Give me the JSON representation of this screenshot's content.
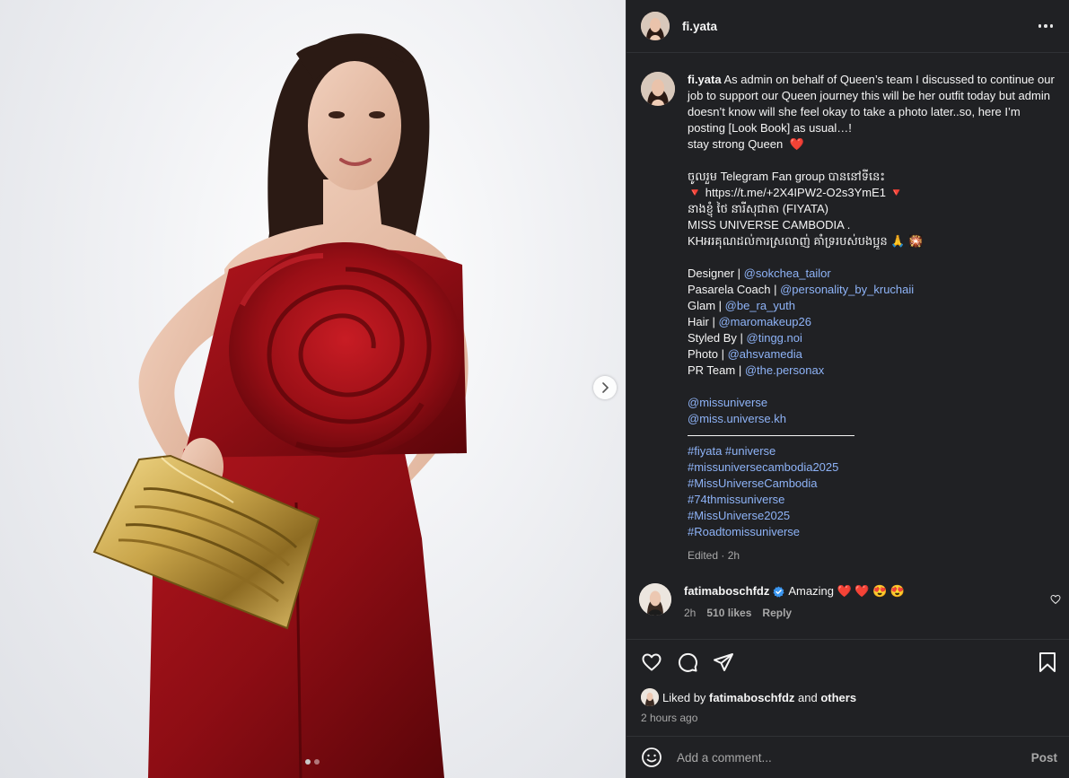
{
  "post": {
    "author": "fi.yata",
    "caption_intro": "As admin on behalf of Queen’s team I discussed to continue our job to support our Queen journey this will be her outfit today but admin doesn’t know will she feel okay to take a photo later..so, here I’m posting [Look Book] as usual…!",
    "caption_lines": [
      {
        "text": "stay strong Queen 󠁧󠁧󠁧 ❤️",
        "link": false
      },
      {
        "text": "",
        "link": false
      },
      {
        "text": "ចូលរួម Telegram Fan group បាននៅទីនេះ",
        "link": false
      },
      {
        "text": "🔻 https://t.me/+2X4IPW2-O2s3YmE1 🔻",
        "link": false
      },
      {
        "text": "នាងខ្ញុំ ថៃ នារីសុជាតា (FIYATA) 󠁧",
        "link": false
      },
      {
        "text": "MISS UNIVERSE CAMBODIA .",
        "link": false
      },
      {
        "text": "KHអរគុណដល់ការស្រលាញ់ គាំទ្ររបស់បងប្អូន 🙏 🎇",
        "link": false
      },
      {
        "text": "",
        "link": false
      }
    ],
    "credits": [
      {
        "role": "Designer | ",
        "handle": "@sokchea_tailor"
      },
      {
        "role": "Pasarela Coach | ",
        "handle": "@personality_by_kruchaii"
      },
      {
        "role": "Glam | ",
        "handle": "@be_ra_yuth"
      },
      {
        "role": "Hair | ",
        "handle": "@maromakeup26"
      },
      {
        "role": "Styled By | ",
        "handle": "@tingg.noi"
      },
      {
        "role": "Photo | ",
        "handle": "@ahsvamedia"
      },
      {
        "role": "PR Team | ",
        "handle": "@the.personax"
      }
    ],
    "mentions": [
      "@missuniverse",
      "@miss.universe.kh"
    ],
    "hashtags": [
      "#fiyata #universe",
      "#missuniversecambodia2025",
      "#MissUniverseCambodia",
      "#74thmissuniverse",
      "#MissUniverse2025",
      "#Roadtomissuniverse"
    ],
    "edited_meta": "Edited · 2h"
  },
  "comment": {
    "user": "fatimaboschfdz",
    "text": "Amazing ❤️ ❤️ 😍 😍",
    "time": "2h",
    "likes": "510 likes",
    "reply": "Reply"
  },
  "likes_summary": {
    "prefix": "Liked by ",
    "user": "fatimaboschfdz",
    "middle": " and ",
    "others": "others",
    "time": "2 hours ago"
  },
  "add_comment": {
    "placeholder": "Add a comment...",
    "post_label": "Post"
  },
  "icons": {
    "header_more": "more-horizontal-icon",
    "like": "heart-icon",
    "comment": "comment-bubble-icon",
    "share": "paper-plane-icon",
    "save": "bookmark-icon",
    "emoji": "smiley-icon",
    "next": "chevron-right-icon"
  },
  "colors": {
    "panel_bg": "#202124",
    "link": "#8eb3f7",
    "muted": "#a8a8a8",
    "dress_red": "#8b0d13",
    "bag_gold": "#c9a54a"
  }
}
